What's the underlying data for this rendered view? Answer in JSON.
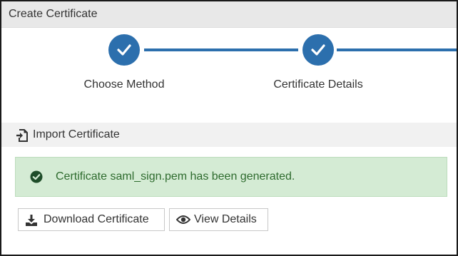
{
  "title": "Create Certificate",
  "steps": [
    {
      "label": "Choose Method",
      "state": "completed"
    },
    {
      "label": "Certificate Details",
      "state": "completed"
    }
  ],
  "section": {
    "icon": "import-file-icon",
    "title": "Import Certificate"
  },
  "alert": {
    "icon": "check-circle-icon",
    "text": "Certificate saml_sign.pem has been generated.",
    "color": "#2e6b2e",
    "background": "#d4ebd4"
  },
  "buttons": {
    "download": {
      "icon": "download-icon",
      "label": "Download Certificate"
    },
    "view": {
      "icon": "eye-icon",
      "label": "View Details"
    }
  },
  "colors": {
    "accent": "#2c6fad"
  }
}
